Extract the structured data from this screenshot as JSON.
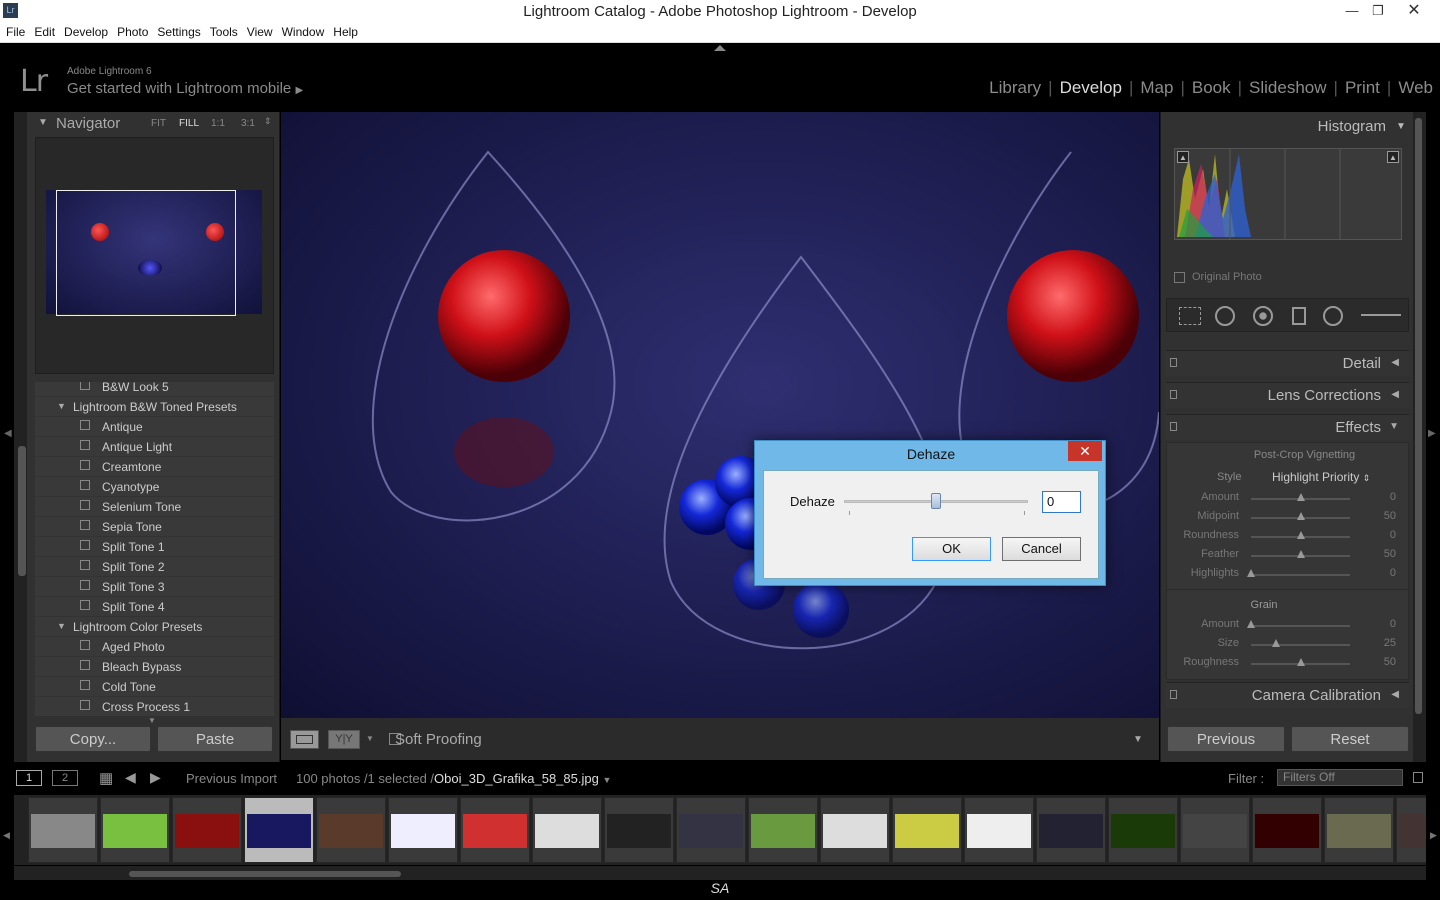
{
  "window": {
    "title": "Lightroom Catalog - Adobe Photoshop Lightroom - Develop",
    "logo": "Lr"
  },
  "menu": [
    "File",
    "Edit",
    "Develop",
    "Photo",
    "Settings",
    "Tools",
    "View",
    "Window",
    "Help"
  ],
  "identity": {
    "logo": "Lr",
    "product": "Adobe Lightroom 6",
    "tagline": "Get started with Lightroom mobile"
  },
  "modules": [
    {
      "label": "Library",
      "active": false
    },
    {
      "label": "Develop",
      "active": true
    },
    {
      "label": "Map",
      "active": false
    },
    {
      "label": "Book",
      "active": false
    },
    {
      "label": "Slideshow",
      "active": false
    },
    {
      "label": "Print",
      "active": false
    },
    {
      "label": "Web",
      "active": false
    }
  ],
  "navigator": {
    "title": "Navigator",
    "zoom": [
      "FIT",
      "FILL",
      "1:1",
      "3:1"
    ],
    "zoom_selected": "FILL"
  },
  "presets": [
    {
      "label": "B&W Look 5",
      "folder": false
    },
    {
      "label": "Lightroom B&W Toned Presets",
      "folder": true
    },
    {
      "label": "Antique",
      "folder": false
    },
    {
      "label": "Antique Light",
      "folder": false
    },
    {
      "label": "Creamtone",
      "folder": false
    },
    {
      "label": "Cyanotype",
      "folder": false
    },
    {
      "label": "Selenium Tone",
      "folder": false
    },
    {
      "label": "Sepia Tone",
      "folder": false
    },
    {
      "label": "Split Tone 1",
      "folder": false
    },
    {
      "label": "Split Tone 2",
      "folder": false
    },
    {
      "label": "Split Tone 3",
      "folder": false
    },
    {
      "label": "Split Tone 4",
      "folder": false
    },
    {
      "label": "Lightroom Color Presets",
      "folder": true
    },
    {
      "label": "Aged Photo",
      "folder": false
    },
    {
      "label": "Bleach Bypass",
      "folder": false
    },
    {
      "label": "Cold Tone",
      "folder": false
    },
    {
      "label": "Cross Process 1",
      "folder": false
    }
  ],
  "left_buttons": {
    "copy": "Copy...",
    "paste": "Paste"
  },
  "toolbar": {
    "soft_proofing": "Soft Proofing"
  },
  "right": {
    "histogram": "Histogram",
    "original_photo": "Original Photo",
    "detail": "Detail",
    "lens": "Lens Corrections",
    "effects": "Effects",
    "vignette_title": "Post-Crop Vignetting",
    "style_label": "Style",
    "style_value": "Highlight Priority",
    "vignette_rows": [
      {
        "label": "Amount",
        "value": "0",
        "pos": 0.5
      },
      {
        "label": "Midpoint",
        "value": "50",
        "pos": 0.5
      },
      {
        "label": "Roundness",
        "value": "0",
        "pos": 0.5
      },
      {
        "label": "Feather",
        "value": "50",
        "pos": 0.5
      },
      {
        "label": "Highlights",
        "value": "0",
        "pos": 0.0
      }
    ],
    "grain_title": "Grain",
    "grain_rows": [
      {
        "label": "Amount",
        "value": "0",
        "pos": 0.0
      },
      {
        "label": "Size",
        "value": "25",
        "pos": 0.25
      },
      {
        "label": "Roughness",
        "value": "50",
        "pos": 0.5
      }
    ],
    "camera": "Camera Calibration",
    "previous": "Previous",
    "reset": "Reset"
  },
  "filmstrip": {
    "pages": [
      "1",
      "2"
    ],
    "source": "Previous Import",
    "count": "100 photos /1 selected /",
    "file": "Oboi_3D_Grafika_58_85.jpg",
    "filter_label": "Filter :",
    "filter_value": "Filters Off"
  },
  "dialog": {
    "title": "Dehaze",
    "label": "Dehaze",
    "value": "0",
    "slider_pos": 0.5,
    "ok": "OK",
    "cancel": "Cancel"
  },
  "footer": "SA"
}
